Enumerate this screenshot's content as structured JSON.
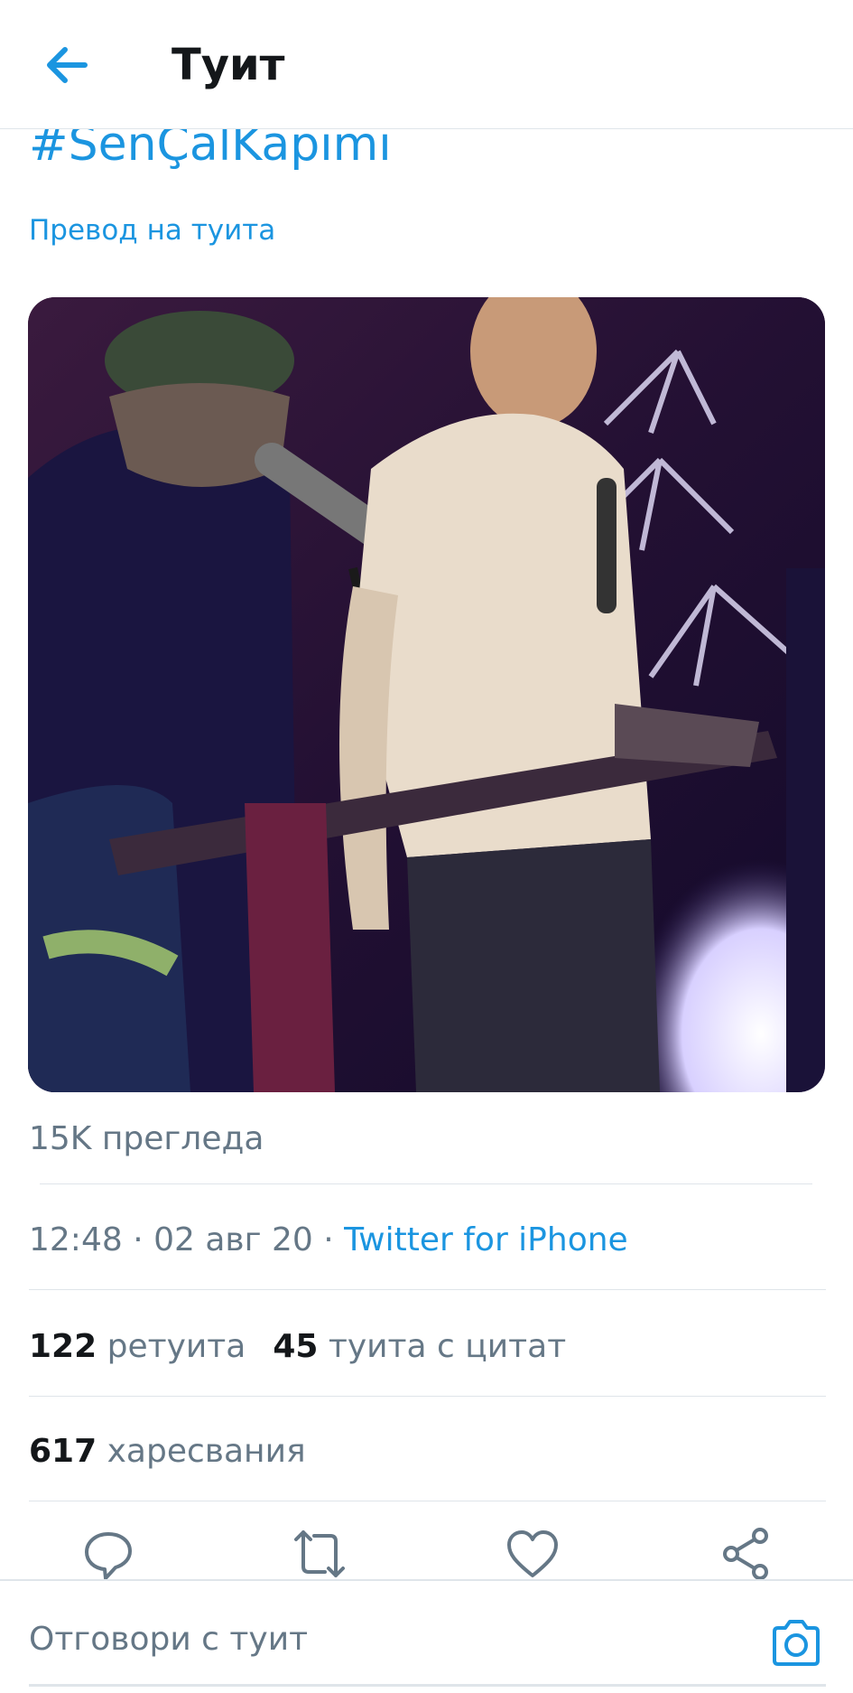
{
  "header": {
    "title": "Туит",
    "back_icon": "arrow-left-icon"
  },
  "tweet": {
    "hashtag": "#SenÇalKapımı",
    "translate_label": "Превод на туита",
    "media_description_icon": "video-thumbnail",
    "views": "15K прегледа",
    "time": "12:48",
    "date": "02 авг 20",
    "separator": " · ",
    "source": "Twitter for iPhone"
  },
  "stats": {
    "retweets_count": "122",
    "retweets_label": "ретуита",
    "quotes_count": "45",
    "quotes_label": "туита с цитат",
    "likes_count": "617",
    "likes_label": "харесвания"
  },
  "actions": {
    "reply_icon": "reply-icon",
    "retweet_icon": "retweet-icon",
    "like_icon": "heart-icon",
    "share_icon": "share-icon"
  },
  "reply_bar": {
    "placeholder": "Отговори с туит",
    "camera_icon": "camera-icon"
  },
  "colors": {
    "accent": "#1b95e0",
    "text_secondary": "#657786",
    "divider": "#dfe5ea"
  }
}
